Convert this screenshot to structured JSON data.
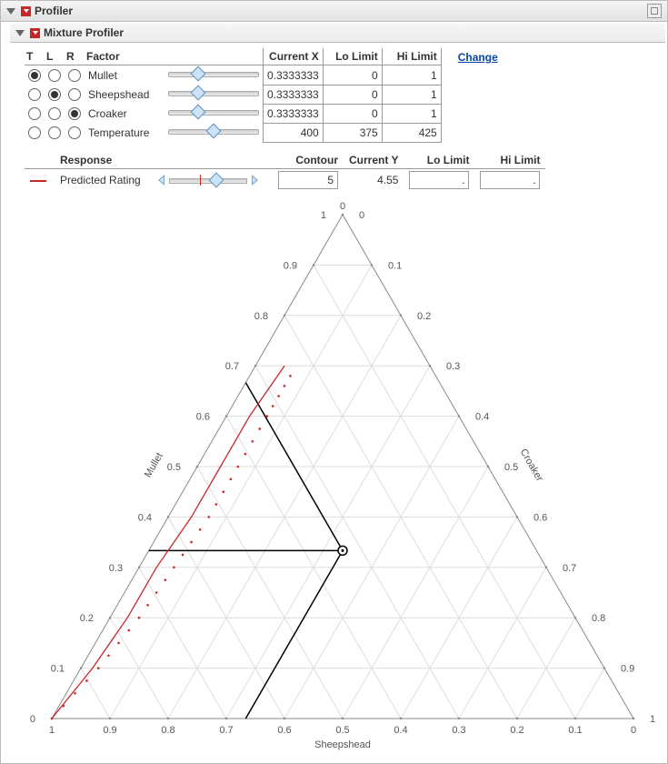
{
  "panel": {
    "title": "Profiler",
    "subtitle": "Mixture Profiler",
    "change_label": "Change"
  },
  "factor_headers": {
    "t": "T",
    "l": "L",
    "r": "R",
    "factor": "Factor",
    "current_x": "Current X",
    "lo": "Lo Limit",
    "hi": "Hi Limit"
  },
  "factors": [
    {
      "name": "Mullet",
      "sel": "T",
      "current": "0.3333333",
      "lo": "0",
      "hi": "1",
      "slider_pct": 33
    },
    {
      "name": "Sheepshead",
      "sel": "L",
      "current": "0.3333333",
      "lo": "0",
      "hi": "1",
      "slider_pct": 33
    },
    {
      "name": "Croaker",
      "sel": "R",
      "current": "0.3333333",
      "lo": "0",
      "hi": "1",
      "slider_pct": 33
    },
    {
      "name": "Temperature",
      "sel": "",
      "current": "400",
      "lo": "375",
      "hi": "425",
      "slider_pct": 50
    }
  ],
  "response_headers": {
    "response": "Response",
    "contour": "Contour",
    "current_y": "Current Y",
    "lo": "Lo Limit",
    "hi": "Hi Limit"
  },
  "response": {
    "name": "Predicted Rating",
    "contour": "5",
    "current_y": "4.55",
    "lo": ".",
    "hi": ".",
    "slider_pct": 60,
    "tick_pct": 40
  },
  "chart_data": {
    "type": "ternary",
    "axes": {
      "top": {
        "label": "Mullet",
        "ticks": [
          "0",
          "0.1",
          "0.2",
          "0.3",
          "0.4",
          "0.5",
          "0.6",
          "0.7",
          "0.8",
          "0.9",
          "1"
        ]
      },
      "bottom": {
        "label": "Sheepshead",
        "ticks": [
          "1",
          "0.9",
          "0.8",
          "0.7",
          "0.6",
          "0.5",
          "0.4",
          "0.3",
          "0.2",
          "0.1",
          "0"
        ]
      },
      "right": {
        "label": "Croaker",
        "ticks": [
          "0",
          "0.1",
          "0.2",
          "0.3",
          "0.4",
          "0.5",
          "0.6",
          "0.7",
          "0.8",
          "0.9",
          "1"
        ]
      }
    },
    "crosshair": {
      "mullet": 0.3333333,
      "sheepshead": 0.3333333,
      "croaker": 0.3333333
    },
    "contours": [
      {
        "level": 5,
        "style": "solid",
        "mullet": [
          0.0,
          0.1,
          0.2,
          0.3,
          0.4,
          0.5,
          0.6,
          0.7
        ],
        "sheepshead": [
          1.0,
          0.88,
          0.77,
          0.67,
          0.56,
          0.46,
          0.36,
          0.25
        ]
      },
      {
        "level": 5,
        "style": "dotted",
        "mullet": [
          0.0,
          0.1,
          0.2,
          0.3,
          0.4,
          0.5,
          0.6,
          0.68
        ],
        "sheepshead": [
          1.0,
          0.87,
          0.75,
          0.64,
          0.53,
          0.43,
          0.33,
          0.25
        ]
      }
    ]
  }
}
